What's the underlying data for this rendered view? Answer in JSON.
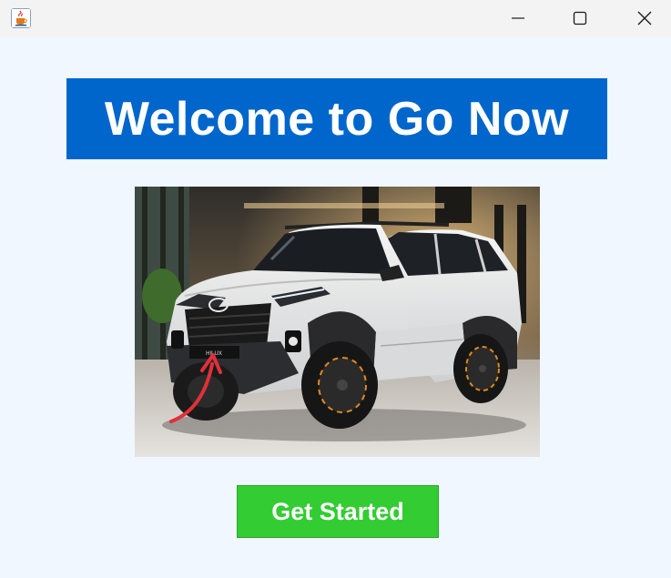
{
  "window": {
    "icon": "java-cup-icon",
    "controls": [
      "minimize-icon",
      "maximize-icon",
      "close-icon"
    ]
  },
  "header": {
    "title": "Welcome to Go Now",
    "background": "#0066cc",
    "text_color": "#ffffff"
  },
  "hero": {
    "subject": "white-suv",
    "badge_text": "HILUX"
  },
  "cta": {
    "label": "Get Started",
    "background": "#33cc33"
  },
  "colors": {
    "page_background": "#f0f7ff",
    "titlebar": "#f3f3f3"
  }
}
